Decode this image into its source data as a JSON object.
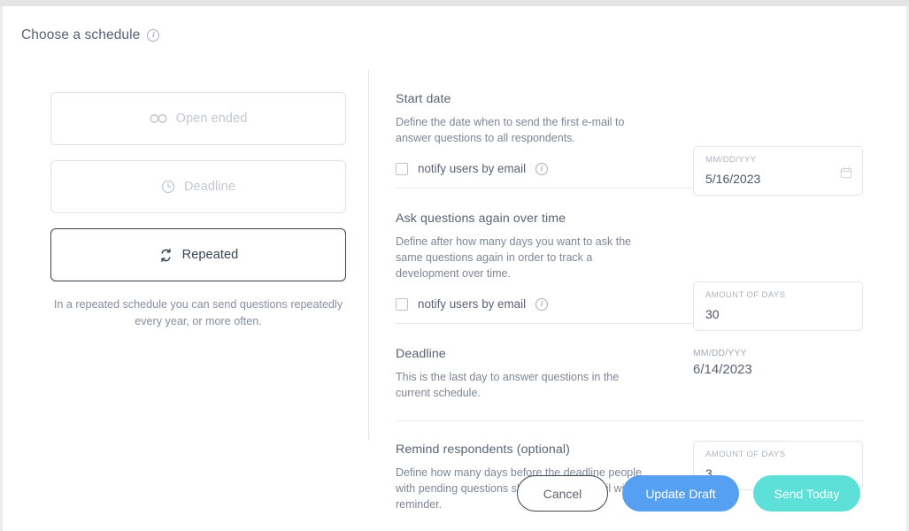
{
  "header": {
    "title": "Choose a schedule",
    "info_icon": "info-icon"
  },
  "schedule_options": [
    {
      "label": "Open ended",
      "icon": "infinity-icon",
      "selected": false
    },
    {
      "label": "Deadline",
      "icon": "clock-icon",
      "selected": false
    },
    {
      "label": "Repeated",
      "icon": "repeat-icon",
      "selected": true
    }
  ],
  "help_text": "In a repeated schedule you can send questions repeatedly every year, or more often.",
  "sections": [
    {
      "title": "Start date",
      "description": "Define the date when to send the first e-mail to answer questions to all respondents.",
      "field_label": "MM/DD/YYY",
      "field_value": "5/16/2023",
      "field_icon": "calendar-icon",
      "checkbox_label": "notify users by email",
      "checkbox_checked": false
    },
    {
      "title": "Ask questions again over time",
      "description": "Define after how many days you want to ask the same questions again in order to track a development over time.",
      "field_label": "AMOUNT OF DAYS",
      "field_value": "30",
      "checkbox_label": "notify users by email",
      "checkbox_checked": false
    },
    {
      "title": "Deadline",
      "description": "This is the last day to answer questions in the current schedule.",
      "field_label": "MM/DD/YYY",
      "field_value": "6/14/2023"
    },
    {
      "title": "Remind respondents (optional)",
      "description": "Define how many days before the deadline people with pending questions should get an e-mail with a reminder.",
      "field_label": "AMOUNT OF DAYS",
      "field_value": "3"
    }
  ],
  "footer": {
    "cancel_label": "Cancel",
    "update_draft_label": "Update Draft",
    "send_today_label": "Send Today"
  },
  "colors": {
    "update_draft_bg": "#56a0f2",
    "send_today_bg": "#5ce0d8",
    "selected_border": "#394353",
    "disabled_text": "#c2c7d1"
  }
}
